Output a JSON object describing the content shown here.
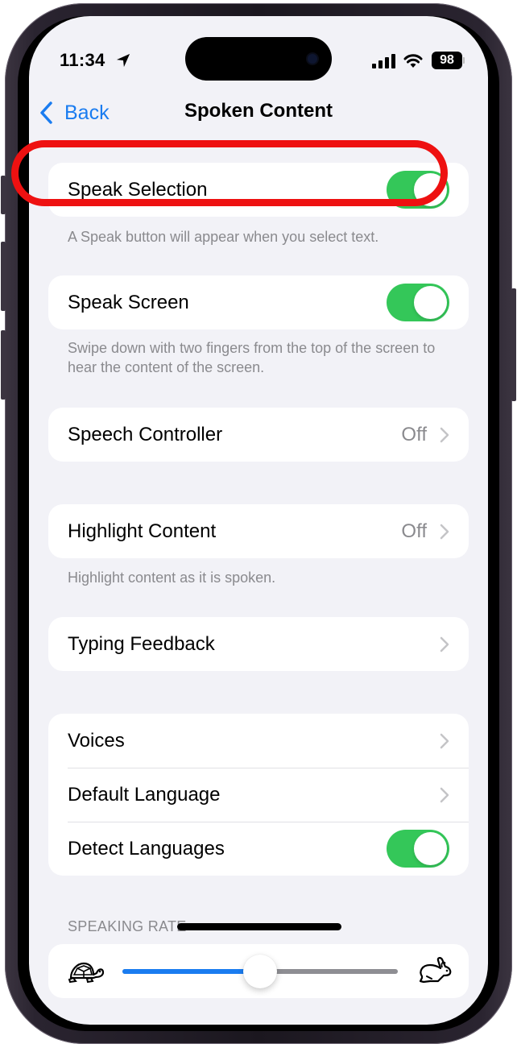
{
  "status_bar": {
    "time": "11:34",
    "battery_percent": "98",
    "icons": [
      "location-arrow-icon",
      "cellular-signal-icon",
      "wifi-icon",
      "battery-icon"
    ]
  },
  "nav": {
    "back_label": "Back",
    "title": "Spoken Content"
  },
  "sections": {
    "speak_selection": {
      "label": "Speak Selection",
      "enabled": true,
      "footer": "A Speak button will appear when you select text.",
      "highlighted": true
    },
    "speak_screen": {
      "label": "Speak Screen",
      "enabled": true,
      "footer": "Swipe down with two fingers from the top of the screen to hear the content of the screen."
    },
    "speech_controller": {
      "label": "Speech Controller",
      "value": "Off"
    },
    "highlight_content": {
      "label": "Highlight Content",
      "value": "Off",
      "footer": "Highlight content as it is spoken."
    },
    "typing_feedback": {
      "label": "Typing Feedback"
    },
    "voices_group": {
      "rows": [
        {
          "label": "Voices"
        },
        {
          "label": "Default Language"
        },
        {
          "label": "Detect Languages",
          "enabled": true
        }
      ]
    },
    "speaking_rate": {
      "header": "SPEAKING RATE",
      "value_fraction": 0.5,
      "min_icon": "turtle-icon",
      "max_icon": "rabbit-icon"
    }
  },
  "colors": {
    "accent": "#1a7cf0",
    "toggle_on": "#34c759",
    "highlight_ring": "#ee1111",
    "background": "#f2f2f7",
    "secondary_text": "#8a8a8e"
  }
}
